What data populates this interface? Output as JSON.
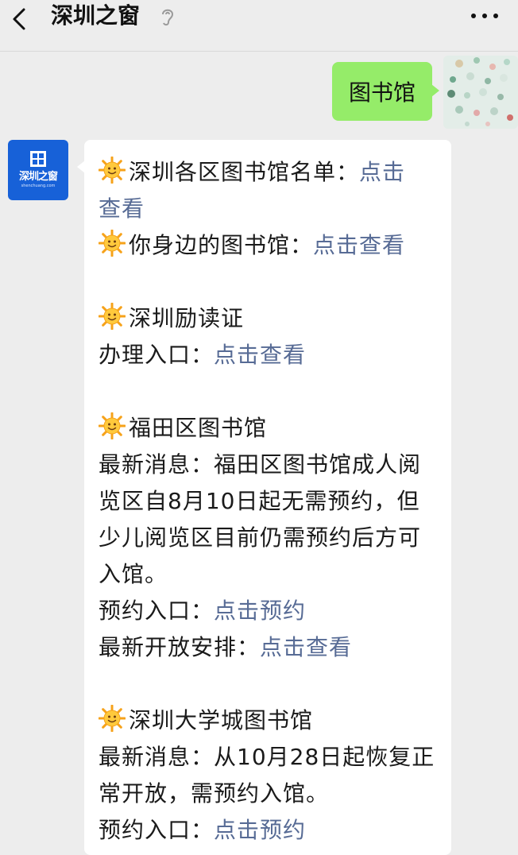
{
  "header": {
    "title": "深圳之窗"
  },
  "outgoing": {
    "text": "图书馆"
  },
  "bot": {
    "logo_text": "深圳之窗",
    "logo_sub": "shenchuang.com"
  },
  "message": {
    "l1_text": "深圳各区图书馆名单：",
    "l1_link": "点击",
    "l1b_link": "查看",
    "l2_text": "你身边的图书馆：",
    "l2_link": "点击查看",
    "l3_text": "深圳励读证",
    "l4_text": "办理入口：",
    "l4_link": "点击查看",
    "l5_text": "福田区图书馆",
    "l6_text": "最新消息：福田区图书馆成人阅览区自8月10日起无需预约，但少儿阅览区目前仍需预约后方可入馆。",
    "l7_text": "预约入口：",
    "l7_link": "点击预约",
    "l8_text": "最新开放安排：",
    "l8_link": "点击查看",
    "l9_text": "深圳大学城图书馆",
    "l10_text": "最新消息：从10月28日起恢复正常开放，需预约入馆。",
    "l11_text": "预约入口：",
    "l11_link": "点击预约"
  },
  "colors": {
    "bubble_out": "#95ec69",
    "link": "#576b95",
    "logo_bg": "#1761d8"
  }
}
